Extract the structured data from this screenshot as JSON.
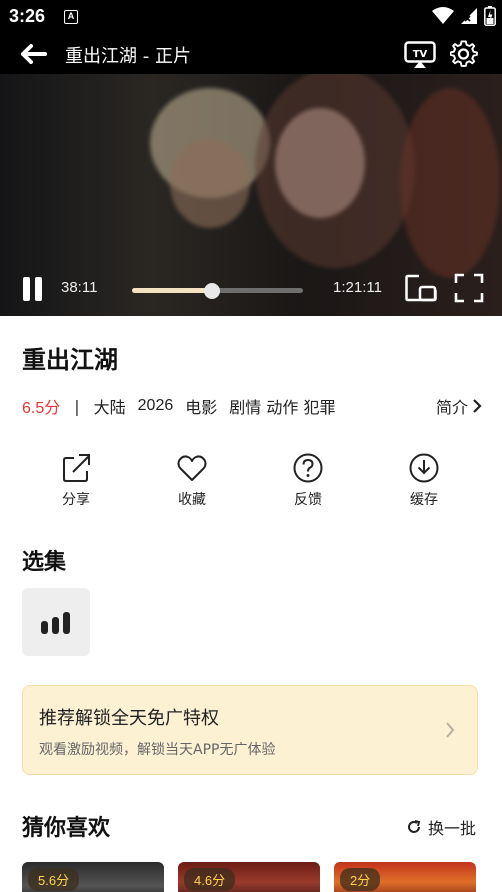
{
  "status_bar": {
    "time": "3:26",
    "notification_letter": "A"
  },
  "player": {
    "title": "重出江湖 - 正片",
    "current_time": "38:11",
    "total_time": "1:21:11",
    "progress": 0.47,
    "cast_label": "TV"
  },
  "movie": {
    "title": "重出江湖",
    "score": "6.5分",
    "separator": "|",
    "region": "大陆",
    "year": "2026",
    "category": "电影",
    "genres": "剧情 动作 犯罪",
    "intro_label": "简介"
  },
  "actions": [
    {
      "label": "分享",
      "icon": "share-icon"
    },
    {
      "label": "收藏",
      "icon": "heart-icon"
    },
    {
      "label": "反馈",
      "icon": "question-icon"
    },
    {
      "label": "缓存",
      "icon": "download-icon"
    }
  ],
  "episodes": {
    "title": "选集"
  },
  "promo": {
    "title": "推荐解锁全天免广特权",
    "subtitle": "观看激励视频，解锁当天APP无广体验"
  },
  "recommend": {
    "title": "猜你喜欢",
    "refresh_label": "换一批",
    "cards": [
      {
        "score": "5.6分"
      },
      {
        "score": "4.6分"
      },
      {
        "score": "2分"
      }
    ]
  },
  "colors": {
    "accent_score": "#e33333",
    "promo_bg": "#fdf1d4",
    "progress_fill": "#f3e3c0"
  }
}
